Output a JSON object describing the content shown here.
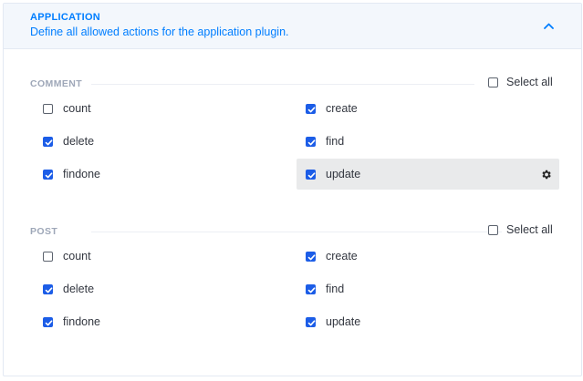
{
  "header": {
    "title": "APPLICATION",
    "subtitle": "Define all allowed actions for the application plugin."
  },
  "sections": [
    {
      "label": "COMMENT",
      "select_all_label": "Select all",
      "select_all_checked": false,
      "permissions": [
        {
          "label": "count",
          "checked": false
        },
        {
          "label": "create",
          "checked": true
        },
        {
          "label": "delete",
          "checked": true
        },
        {
          "label": "find",
          "checked": true
        },
        {
          "label": "findone",
          "checked": true
        },
        {
          "label": "update",
          "checked": true,
          "active": true,
          "icon": "gear-icon"
        }
      ]
    },
    {
      "label": "POST",
      "select_all_label": "Select all",
      "select_all_checked": false,
      "permissions": [
        {
          "label": "count",
          "checked": false
        },
        {
          "label": "create",
          "checked": true
        },
        {
          "label": "delete",
          "checked": true
        },
        {
          "label": "find",
          "checked": true
        },
        {
          "label": "findone",
          "checked": true
        },
        {
          "label": "update",
          "checked": true
        }
      ]
    }
  ],
  "colors": {
    "accent": "#007eff",
    "checkbox_checked": "#1c5de7",
    "header_bg": "#f3f7fc",
    "active_row_bg": "#e9eaeb"
  }
}
